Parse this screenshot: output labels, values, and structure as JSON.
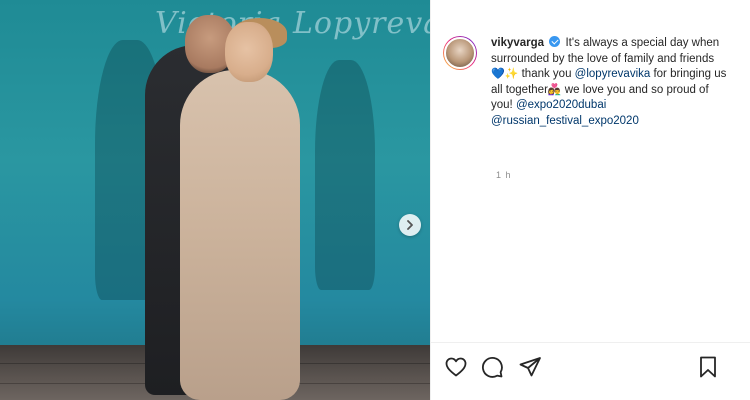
{
  "post": {
    "image": {
      "wall_sign": "Victoria Lopyreva",
      "alt": "photo"
    },
    "author": {
      "username": "vikyvarga",
      "verified": true
    },
    "caption": {
      "part1": "It's always a special day when surrounded by the love of family and friends",
      "emoji1": "💙✨",
      "part2": " thank you ",
      "mention1": "@lopyrevavika",
      "part3": " for bringing us all together",
      "emoji2": "👩‍❤️‍👨",
      "part4": " we love you and so proud of you! ",
      "hashtag1": "@expo2020dubai",
      "hashtag2": "@russian_festival_expo2020"
    },
    "timestamp": "1 h",
    "icons": {
      "like": "heart-icon",
      "comment": "comment-icon",
      "share": "paper-plane-icon",
      "save": "bookmark-icon",
      "next": "chevron-right-icon"
    },
    "colors": {
      "link": "#00376b",
      "verified": "#3897f0",
      "wall": "#2a97a1"
    }
  }
}
